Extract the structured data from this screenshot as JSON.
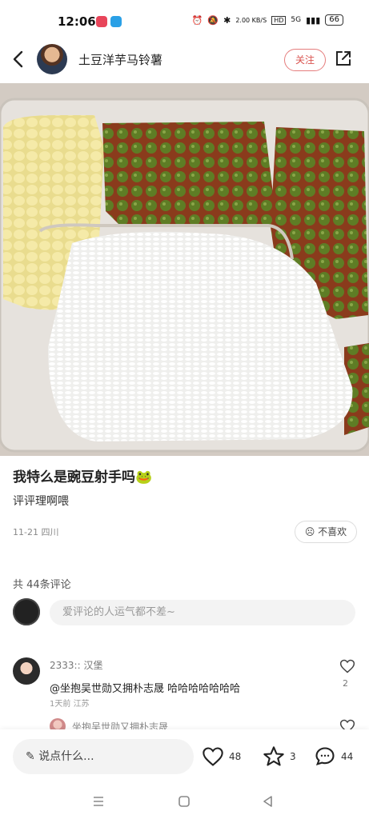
{
  "status_bar": {
    "time": "12:06",
    "net_speed": "2.00 KB/S",
    "hd": "HD",
    "signal": "5G",
    "battery": "66"
  },
  "header": {
    "back_icon": "chevron-left-icon",
    "author_name": "土豆洋芋马铃薯",
    "follow_label": "关注",
    "share_icon": "share-icon"
  },
  "post": {
    "title": "我特么是豌豆射手吗🐸",
    "subtitle": "评评理啊喂",
    "date": "11-21",
    "location": "四川",
    "dislike_label": "不喜欢"
  },
  "comments": {
    "count_label": "共 44条评论",
    "input_placeholder": "爱评论的人运气都不差~",
    "items": [
      {
        "author": "2333:: 汉堡",
        "mention": "@坐抱吴世勋又拥朴志晟",
        "text": "哈哈哈哈哈哈哈",
        "time": "1天前",
        "location": "江苏",
        "likes": "2"
      }
    ],
    "reply_preview_author": "坐抱吴世勋又拥朴志晟"
  },
  "bottom_bar": {
    "say_placeholder": "说点什么...",
    "likes": "48",
    "stars": "3",
    "comments": "44"
  },
  "colors": {
    "accent": "#d9534f",
    "rice": "#f4f4f2",
    "corn": "#f1e59a",
    "peas": "#5b7b23",
    "sauce": "#8a3b1c"
  }
}
